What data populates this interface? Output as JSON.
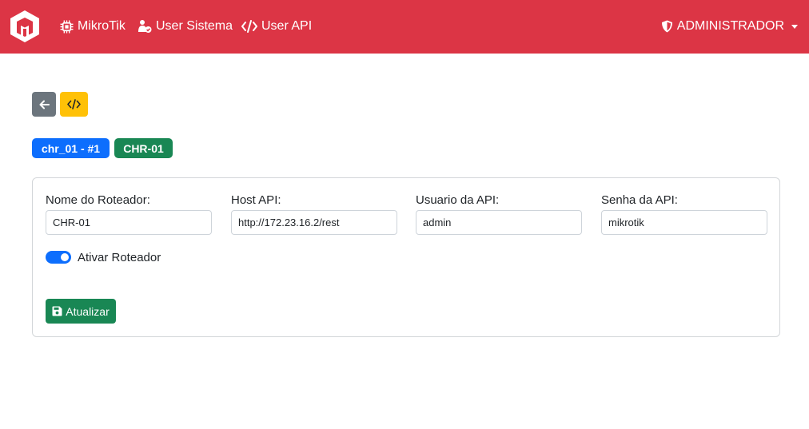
{
  "navbar": {
    "brand_color": "#dc3545",
    "logo_icon": "mikrotik-cube-logo",
    "links": [
      {
        "label": "MikroTik",
        "icon": "chip-icon"
      },
      {
        "label": "User Sistema",
        "icon": "user-check-icon"
      },
      {
        "label": "User API",
        "icon": "code-icon"
      }
    ],
    "user_menu": {
      "label": "ADMINISTRADOR",
      "icon": "shield-icon"
    }
  },
  "toolbar": {
    "back_button_icon": "arrow-left-icon",
    "code_button_icon": "code-icon"
  },
  "badges": {
    "router_id": "chr_01 - #1",
    "router_name": "CHR-01"
  },
  "form": {
    "fields": [
      {
        "label": "Nome do Roteador:",
        "value": "CHR-01"
      },
      {
        "label": "Host API:",
        "value": "http://172.23.16.2/rest"
      },
      {
        "label": "Usuario da API:",
        "value": "admin"
      },
      {
        "label": "Senha da API:",
        "value": "mikrotik"
      }
    ],
    "toggle": {
      "label": "Ativar Roteador",
      "checked": true
    },
    "submit": {
      "label": "Atualizar",
      "icon": "save-icon"
    }
  }
}
